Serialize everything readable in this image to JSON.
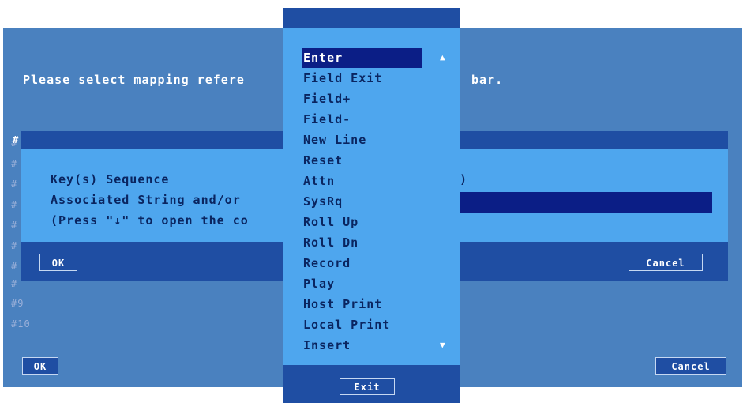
{
  "back_window": {
    "prompt_left": "Please select mapping refere",
    "prompt_right": "bar.",
    "row_markers": [
      "#",
      "#",
      "#",
      "#",
      "#",
      "#",
      "#",
      "#"
    ],
    "row_9": "#9",
    "row_10": "#10",
    "ok_label": "OK",
    "cancel_label": "Cancel"
  },
  "mapping_dialog": {
    "title_marker": "#",
    "line1": "Key(s) Sequence",
    "line2": "Associated String and/or",
    "line3": "(Press \"↓\" to open the co",
    "paren": ")",
    "ok_label": "OK",
    "cancel_label": "Cancel"
  },
  "dropdown": {
    "items": [
      "Enter",
      "Field Exit",
      "Field+",
      "Field-",
      "New Line",
      "Reset",
      "Attn",
      "SysRq",
      "Roll Up",
      "Roll Dn",
      "Record",
      "Play",
      "Host Print",
      "Local Print",
      "Insert"
    ],
    "selected_index": 0,
    "scroll_up_icon": "▲",
    "scroll_down_icon": "▼",
    "exit_label": "Exit"
  },
  "colors": {
    "panel_blue": "#4a81bf",
    "navy": "#1f4ea3",
    "light_blue": "#4ea6ee",
    "selection": "#0b1e86"
  }
}
